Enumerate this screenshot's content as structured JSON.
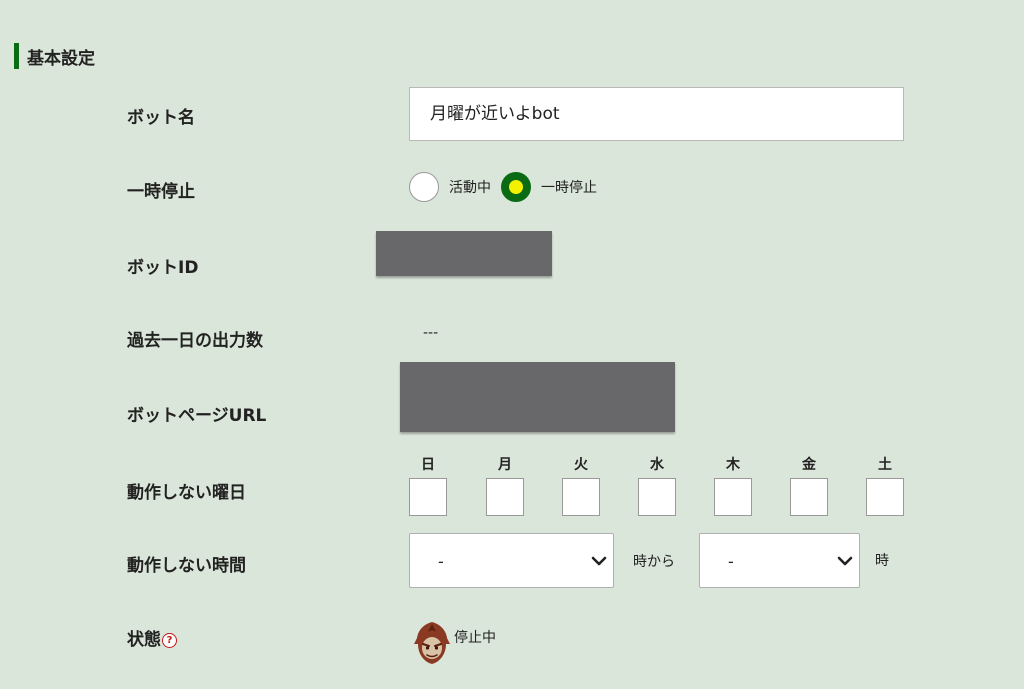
{
  "section": {
    "title": "基本設定"
  },
  "bot_name": {
    "label": "ボット名",
    "value": "月曜が近いよbot"
  },
  "pause": {
    "label": "一時停止",
    "options": [
      {
        "label": "活動中",
        "checked": false
      },
      {
        "label": "一時停止",
        "checked": true
      }
    ]
  },
  "bot_id": {
    "label": "ボットID"
  },
  "output_count": {
    "label": "過去一日の出力数",
    "value": "---"
  },
  "bot_page_url": {
    "label": "ボットページURL"
  },
  "inactive_days": {
    "label": "動作しない曜日",
    "days": [
      "日",
      "月",
      "火",
      "水",
      "木",
      "金",
      "土"
    ]
  },
  "inactive_hours": {
    "label": "動作しない時間",
    "from_value": "-",
    "from_suffix": "時から",
    "to_value": "-",
    "to_suffix": "時"
  },
  "status": {
    "label": "状態",
    "help": "?",
    "value": "停止中"
  },
  "colors": {
    "background": "#dbe6da",
    "accent": "#0a6b14",
    "radio_dot": "#f3f000",
    "redaction": "#68686b",
    "help": "#c21818"
  }
}
